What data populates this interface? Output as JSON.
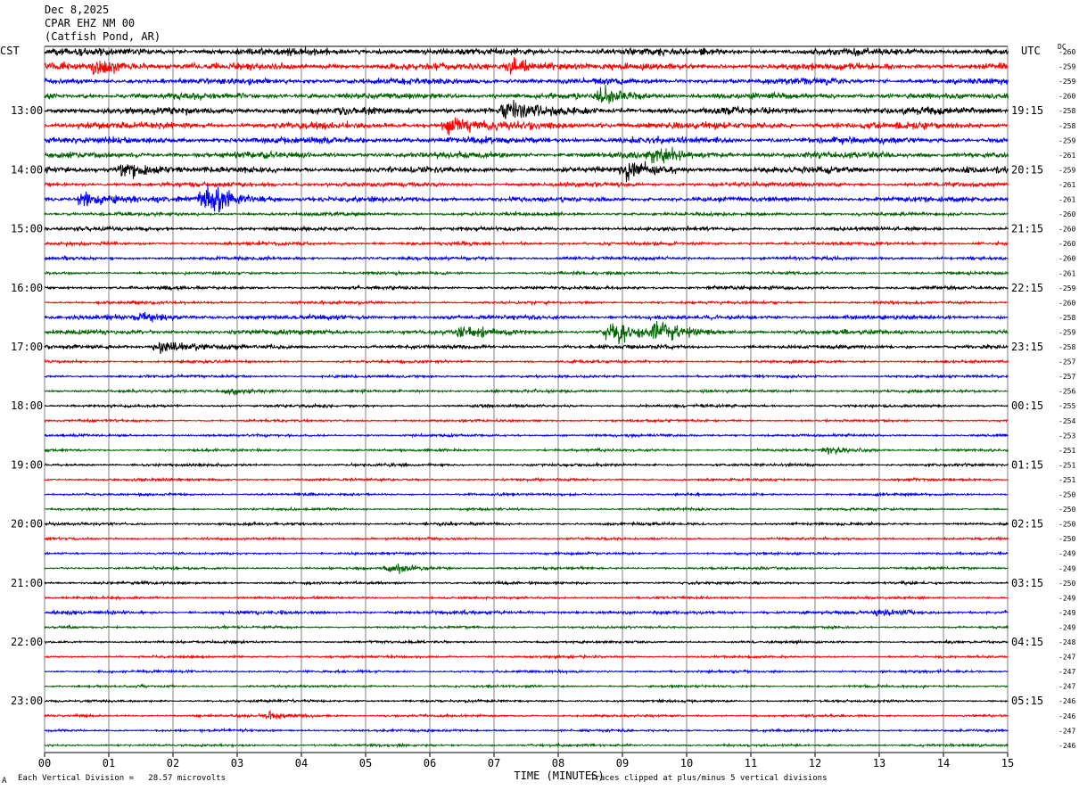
{
  "header": {
    "date": "Dec 8,2025",
    "station": "CPAR EHZ NM 00",
    "location": "(Catfish Pond, AR)"
  },
  "left_axis_label": "CST",
  "right_axis_label": "UTC",
  "dc_label": "DC",
  "footer": {
    "scale_note": "Each Vertical Division =   28.57 microvolts",
    "clip_note": "Traces clipped at plus/minus 5 vertical divisions",
    "corner_mark": "A"
  },
  "colors": {
    "trace_cycle": [
      "#000000",
      "#ff0000",
      "#0000ff",
      "#006400"
    ],
    "grid": "#808080"
  },
  "chart_data": {
    "type": "line",
    "title": "CPAR EHZ NM 00",
    "xlabel": "TIME (MINUTES)",
    "xlim": [
      0,
      15
    ],
    "x_ticks": [
      "00",
      "01",
      "02",
      "03",
      "04",
      "05",
      "06",
      "07",
      "08",
      "09",
      "10",
      "11",
      "12",
      "13",
      "14",
      "15"
    ],
    "rows_per_hour": 4,
    "minutes_per_row": 15,
    "cst_labels": [
      {
        "row": 4,
        "label": "13:00"
      },
      {
        "row": 8,
        "label": "14:00"
      },
      {
        "row": 12,
        "label": "15:00"
      },
      {
        "row": 16,
        "label": "16:00"
      },
      {
        "row": 20,
        "label": "17:00"
      },
      {
        "row": 24,
        "label": "18:00"
      },
      {
        "row": 28,
        "label": "19:00"
      },
      {
        "row": 32,
        "label": "20:00"
      },
      {
        "row": 36,
        "label": "21:00"
      },
      {
        "row": 40,
        "label": "22:00"
      },
      {
        "row": 44,
        "label": "23:00"
      }
    ],
    "utc_labels": [
      {
        "row": 4,
        "label": "19:15"
      },
      {
        "row": 8,
        "label": "20:15"
      },
      {
        "row": 12,
        "label": "21:15"
      },
      {
        "row": 16,
        "label": "22:15"
      },
      {
        "row": 20,
        "label": "23:15"
      },
      {
        "row": 24,
        "label": "00:15"
      },
      {
        "row": 28,
        "label": "01:15"
      },
      {
        "row": 32,
        "label": "02:15"
      },
      {
        "row": 36,
        "label": "03:15"
      },
      {
        "row": 40,
        "label": "04:15"
      },
      {
        "row": 44,
        "label": "05:15"
      }
    ],
    "dc_offsets": [
      "-260",
      "-259",
      "-259",
      "-260",
      "-258",
      "-258",
      "-259",
      "-261",
      "-259",
      "-261",
      "-261",
      "-260",
      "-260",
      "-260",
      "-260",
      "-261",
      "-259",
      "-260",
      "-258",
      "-259",
      "-258",
      "-257",
      "-257",
      "-256",
      "-255",
      "-254",
      "-253",
      "-251",
      "-251",
      "-251",
      "-250",
      "-250",
      "-250",
      "-250",
      "-249",
      "-249",
      "-250",
      "-249",
      "-249",
      "-249",
      "-248",
      "-247",
      "-247",
      "-247",
      "-246",
      "-246",
      "-247",
      "-246"
    ],
    "row_amplitude": [
      3.0,
      2.8,
      2.5,
      2.5,
      3.0,
      2.8,
      2.8,
      2.6,
      2.6,
      1.8,
      2.2,
      1.5,
      1.6,
      1.4,
      1.4,
      1.2,
      1.4,
      1.2,
      1.8,
      2.0,
      1.6,
      1.1,
      1.1,
      1.2,
      1.1,
      1.0,
      1.1,
      1.0,
      1.1,
      1.1,
      1.0,
      1.0,
      1.1,
      1.0,
      1.0,
      1.0,
      1.1,
      1.0,
      1.4,
      1.0,
      1.0,
      1.0,
      1.0,
      1.0,
      1.0,
      1.0,
      1.0,
      1.0
    ],
    "events": [
      {
        "row": 1,
        "minute": 0.8,
        "amp": 6
      },
      {
        "row": 1,
        "minute": 7.3,
        "amp": 6
      },
      {
        "row": 3,
        "minute": 8.7,
        "amp": 6
      },
      {
        "row": 4,
        "minute": 7.2,
        "amp": 7
      },
      {
        "row": 5,
        "minute": 6.3,
        "amp": 8
      },
      {
        "row": 7,
        "minute": 9.5,
        "amp": 6
      },
      {
        "row": 8,
        "minute": 1.2,
        "amp": 7
      },
      {
        "row": 8,
        "minute": 9.1,
        "amp": 7
      },
      {
        "row": 10,
        "minute": 2.5,
        "amp": 14
      },
      {
        "row": 10,
        "minute": 0.6,
        "amp": 7
      },
      {
        "row": 18,
        "minute": 1.5,
        "amp": 4
      },
      {
        "row": 19,
        "minute": 8.8,
        "amp": 10
      },
      {
        "row": 19,
        "minute": 9.6,
        "amp": 8
      },
      {
        "row": 19,
        "minute": 6.5,
        "amp": 5
      },
      {
        "row": 20,
        "minute": 1.8,
        "amp": 6
      },
      {
        "row": 23,
        "minute": 2.9,
        "amp": 3
      },
      {
        "row": 27,
        "minute": 12.2,
        "amp": 3
      },
      {
        "row": 35,
        "minute": 5.4,
        "amp": 4
      },
      {
        "row": 38,
        "minute": 13.0,
        "amp": 3
      },
      {
        "row": 45,
        "minute": 3.5,
        "amp": 3
      }
    ]
  }
}
